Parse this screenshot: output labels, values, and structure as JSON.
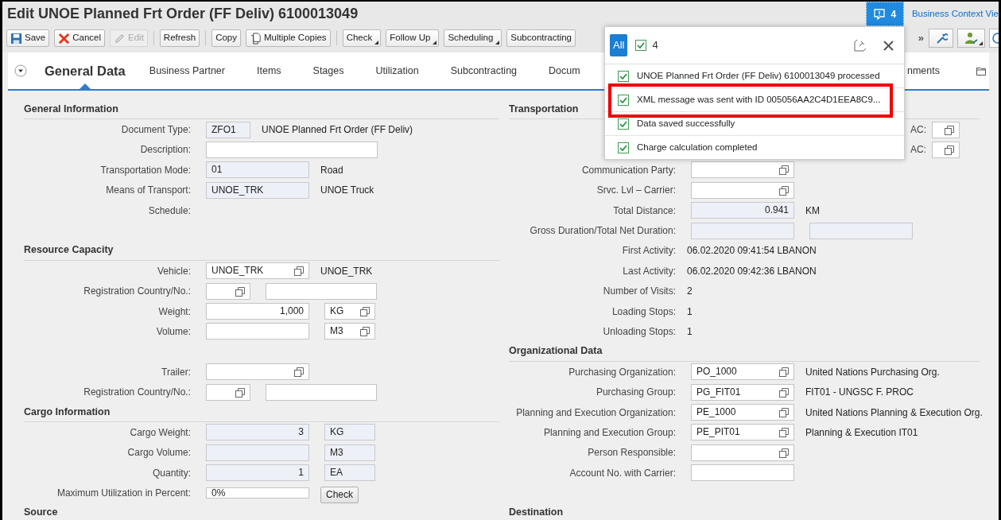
{
  "window": {
    "title": "Edit UNOE Planned Frt Order (FF Deliv) 6100013049"
  },
  "notifications": {
    "count": "4"
  },
  "header_link": "Business Context Vie",
  "toolbar": {
    "groups": [
      [
        {
          "label": "Save",
          "kind": "save",
          "disabled": false,
          "menu": false
        },
        {
          "label": "Cancel",
          "kind": "cancel",
          "disabled": false,
          "menu": false
        },
        {
          "label": "Edit",
          "kind": "edit",
          "disabled": true,
          "menu": false
        }
      ],
      [
        {
          "label": "Refresh",
          "kind": "plain",
          "disabled": false,
          "menu": false
        }
      ],
      [
        {
          "label": "Copy",
          "kind": "plain",
          "disabled": false,
          "menu": false
        },
        {
          "label": "Multiple Copies",
          "kind": "copy",
          "disabled": false,
          "menu": false
        }
      ],
      [
        {
          "label": "Check",
          "kind": "plain",
          "disabled": false,
          "menu": true
        },
        {
          "label": "Follow Up",
          "kind": "plain",
          "disabled": false,
          "menu": true
        },
        {
          "label": "Scheduling",
          "kind": "plain",
          "disabled": false,
          "menu": true
        },
        {
          "label": "Subcontracting",
          "kind": "plain",
          "disabled": false,
          "menu": false
        }
      ]
    ],
    "overflow": "»"
  },
  "tabs": [
    {
      "label": "General Data",
      "selected": true
    },
    {
      "label": "Business Partner",
      "selected": false
    },
    {
      "label": "Items",
      "selected": false
    },
    {
      "label": "Stages",
      "selected": false
    },
    {
      "label": "Utilization",
      "selected": false
    },
    {
      "label": "Subcontracting",
      "selected": false
    },
    {
      "label": "Docum",
      "selected": false
    }
  ],
  "tabs_right": [
    {
      "label": "nments",
      "selected": false
    }
  ],
  "columns": [
    {
      "sections": [
        {
          "title": "General Information",
          "rows": [
            {
              "label": "Document Type:",
              "items": [
                {
                  "kind": "code",
                  "value": "ZFO1",
                  "readonly": true,
                  "value_help": false
                },
                {
                  "kind": "text",
                  "text": "UNOE Planned Frt Order (FF Deliv)"
                }
              ]
            },
            {
              "label": "Description:",
              "items": [
                {
                  "kind": "description",
                  "readonly": false,
                  "value_help": false
                }
              ]
            },
            {
              "label": "Transportation Mode:",
              "items": [
                {
                  "kind": "value",
                  "value": "01",
                  "readonly": true,
                  "value_help": false
                },
                {
                  "kind": "text",
                  "text": "Road"
                }
              ]
            },
            {
              "label": "Means of Transport:",
              "items": [
                {
                  "kind": "value",
                  "value": "UNOE_TRK",
                  "readonly": true,
                  "value_help": false
                },
                {
                  "kind": "text",
                  "text": "UNOE Truck"
                }
              ]
            },
            {
              "label": "Schedule:",
              "items": []
            },
            {
              "kind": "blank"
            }
          ]
        },
        {
          "title": "Resource Capacity",
          "rows": [
            {
              "label": "Vehicle:",
              "items": [
                {
                  "kind": "value",
                  "value": "UNOE_TRK",
                  "readonly": false,
                  "value_help": true
                },
                {
                  "kind": "text",
                  "text": "UNOE_TRK"
                }
              ]
            },
            {
              "label": "Registration Country/No.:",
              "items": [
                {
                  "kind": "code",
                  "readonly": false,
                  "value_help": true
                },
                {
                  "kind": "number",
                  "readonly": false,
                  "value_help": false
                }
              ]
            },
            {
              "label": "Weight:",
              "items": [
                {
                  "kind": "amount",
                  "value": "1,000",
                  "readonly": false,
                  "value_help": false
                },
                {
                  "kind": "unit",
                  "value": "KG",
                  "readonly": false,
                  "value_help": true
                }
              ]
            },
            {
              "label": "Volume:",
              "items": [
                {
                  "kind": "amount",
                  "readonly": false,
                  "value_help": false
                },
                {
                  "kind": "unit",
                  "value": "M3",
                  "readonly": false,
                  "value_help": true
                }
              ]
            },
            {
              "kind": "blank"
            },
            {
              "label": "Trailer:",
              "items": [
                {
                  "kind": "value",
                  "readonly": false,
                  "value_help": true
                }
              ]
            },
            {
              "label": "Registration Country/No.:",
              "items": [
                {
                  "kind": "code",
                  "readonly": false,
                  "value_help": true
                },
                {
                  "kind": "number",
                  "readonly": false,
                  "value_help": false
                }
              ]
            }
          ]
        },
        {
          "title": "Cargo Information",
          "rows": [
            {
              "label": "Cargo Weight:",
              "items": [
                {
                  "kind": "amount",
                  "value": "3",
                  "readonly": true,
                  "value_help": false
                },
                {
                  "kind": "unit",
                  "value": "KG",
                  "readonly": true,
                  "value_help": false
                }
              ]
            },
            {
              "label": "Cargo Volume:",
              "items": [
                {
                  "kind": "amount",
                  "readonly": true,
                  "value_help": false
                },
                {
                  "kind": "unit",
                  "value": "M3",
                  "readonly": true,
                  "value_help": false
                }
              ]
            },
            {
              "label": "Quantity:",
              "items": [
                {
                  "kind": "amount",
                  "value": "1",
                  "readonly": true,
                  "value_help": false
                },
                {
                  "kind": "unit",
                  "value": "EA",
                  "readonly": true,
                  "value_help": false
                }
              ]
            },
            {
              "label": "Maximum Utilization in Percent:",
              "items": [
                {
                  "kind": "compact",
                  "value": "0%",
                  "readonly": false,
                  "value_help": false
                },
                {
                  "kind": "button",
                  "text": "Check"
                }
              ]
            }
          ]
        },
        {
          "title": "Source"
        }
      ]
    },
    {
      "sections": [
        {
          "title": "Transportation",
          "rows": [
            {
              "items": [
                {
                  "kind": "side_label",
                  "text": "AC:"
                },
                {
                  "kind": "side_value",
                  "readonly": false,
                  "value_help": true
                }
              ]
            },
            {
              "items": [
                {
                  "kind": "side_label",
                  "text": "AC:"
                },
                {
                  "kind": "side_value",
                  "readonly": false,
                  "value_help": true
                }
              ]
            },
            {
              "label": "Communication Party:",
              "items": [
                {
                  "kind": "value",
                  "readonly": false,
                  "value_help": true
                }
              ]
            },
            {
              "label": "Srvc. Lvl – Carrier:",
              "items": [
                {
                  "kind": "value",
                  "readonly": false,
                  "value_help": true
                }
              ]
            },
            {
              "label": "Total Distance:",
              "items": [
                {
                  "kind": "amount",
                  "value": "0.941",
                  "readonly": true,
                  "value_help": false
                },
                {
                  "kind": "text",
                  "text": "KM"
                }
              ]
            },
            {
              "label": "Gross Duration/Total Net Duration:",
              "items": [
                {
                  "kind": "value",
                  "readonly": true,
                  "value_help": false
                },
                {
                  "kind": "value",
                  "readonly": true,
                  "value_help": false
                }
              ]
            },
            {
              "label": "First Activity:",
              "items": [
                {
                  "kind": "text",
                  "text": "06.02.2020 09:41:54 LBANON"
                }
              ]
            },
            {
              "label": "Last Activity:",
              "items": [
                {
                  "kind": "text",
                  "text": "06.02.2020 09:42:36 LBANON"
                }
              ]
            },
            {
              "label": "Number of Visits:",
              "items": [
                {
                  "kind": "text",
                  "text": "2"
                }
              ]
            },
            {
              "label": "Loading Stops:",
              "items": [
                {
                  "kind": "text",
                  "text": "1"
                }
              ]
            },
            {
              "label": "Unloading Stops:",
              "items": [
                {
                  "kind": "text",
                  "text": "1"
                }
              ]
            }
          ]
        },
        {
          "title": "Organizational Data",
          "rows": [
            {
              "label": "Purchasing Organization:",
              "items": [
                {
                  "kind": "value",
                  "value": "PO_1000",
                  "readonly": false,
                  "value_help": true
                },
                {
                  "kind": "text",
                  "text": "United Nations Purchasing Org."
                }
              ]
            },
            {
              "label": "Purchasing Group:",
              "items": [
                {
                  "kind": "value",
                  "value": "PG_FIT01",
                  "readonly": false,
                  "value_help": true
                },
                {
                  "kind": "text",
                  "text": "FIT01 - UNGSC F. PROC"
                }
              ]
            },
            {
              "label": "Planning and Execution Organization:",
              "items": [
                {
                  "kind": "value",
                  "value": "PE_1000",
                  "readonly": false,
                  "value_help": true
                },
                {
                  "kind": "text",
                  "text": "United Nations Planning & Execution Org."
                }
              ]
            },
            {
              "label": "Planning and Execution Group:",
              "items": [
                {
                  "kind": "value",
                  "value": "PE_PIT01",
                  "readonly": false,
                  "value_help": true
                },
                {
                  "kind": "text",
                  "text": "Planning & Execution IT01"
                }
              ]
            },
            {
              "label": "Person Responsible:",
              "items": [
                {
                  "kind": "value",
                  "readonly": false,
                  "value_help": true
                }
              ]
            },
            {
              "label": "Account No. with Carrier:",
              "items": [
                {
                  "kind": "value",
                  "readonly": false,
                  "value_help": false
                }
              ]
            },
            {
              "kind": "blank"
            }
          ]
        },
        {
          "title": "Destination"
        }
      ]
    }
  ],
  "message_popover": {
    "filters": [
      {
        "kind": "all",
        "label": "All",
        "selected": true
      },
      {
        "kind": "success",
        "label": "4",
        "selected": false
      }
    ],
    "messages": [
      {
        "text": "UNOE Planned Frt Order (FF Deliv) 6100013049 processed",
        "highlighted": false
      },
      {
        "text": "XML message was sent with ID 005056AA2C4D1EEA8C9...",
        "highlighted": true
      },
      {
        "text": "Data saved successfully",
        "highlighted": false
      },
      {
        "text": "Charge calculation completed",
        "highlighted": false
      }
    ]
  }
}
